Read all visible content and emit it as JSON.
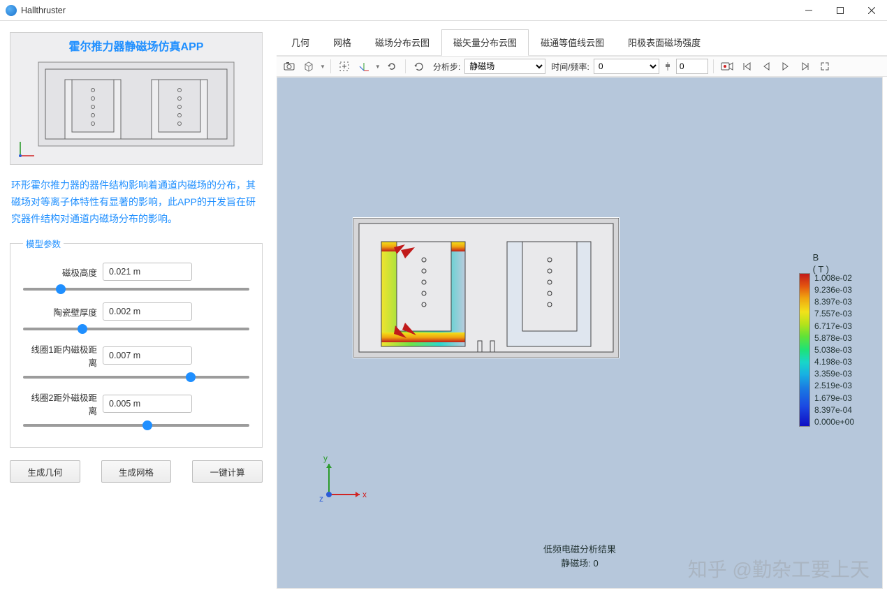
{
  "window": {
    "title": "Hallthruster"
  },
  "sidebar": {
    "preview_title": "霍尔推力器静磁场仿真APP",
    "description": "环形霍尔推力器的器件结构影响着通道内磁场的分布，其磁场对等离子体特性有显著的影响，此APP的开发旨在研究器件结构对通道内磁场分布的影响。",
    "params_legend": "模型参数",
    "params": [
      {
        "label": "磁极高度",
        "value": "0.021 m",
        "slider": 15
      },
      {
        "label": "陶瓷壁厚度",
        "value": "0.002 m",
        "slider": 25
      },
      {
        "label": "线圈1距内磁极距离",
        "value": "0.007 m",
        "slider": 75
      },
      {
        "label": "线圈2距外磁极距离",
        "value": "0.005 m",
        "slider": 55
      }
    ]
  },
  "actions": {
    "gen_geom": "生成几何",
    "gen_mesh": "生成网格",
    "compute": "一键计算"
  },
  "tabs": [
    {
      "label": "几何"
    },
    {
      "label": "网格"
    },
    {
      "label": "磁场分布云图"
    },
    {
      "label": "磁矢量分布云图",
      "active": true
    },
    {
      "label": "磁通等值线云图"
    },
    {
      "label": "阳极表面磁场强度"
    }
  ],
  "toolbar": {
    "analysis_step_label": "分析步:",
    "analysis_step_value": "静磁场",
    "time_freq_label": "时间/频率:",
    "time_freq_value": "0",
    "spin_value": "0"
  },
  "viewport": {
    "caption_line1": "低频电磁分析结果",
    "caption_line2": "静磁场: 0",
    "legend_title1": "B",
    "legend_title2": "( T )",
    "axes": {
      "x": "x",
      "y": "y",
      "z": "z"
    }
  },
  "chart_data": {
    "type": "heatmap",
    "title": "B (T)",
    "colorbar_ticks": [
      "1.008e-02",
      "9.236e-03",
      "8.397e-03",
      "7.557e-03",
      "6.717e-03",
      "5.878e-03",
      "5.038e-03",
      "4.198e-03",
      "3.359e-03",
      "2.519e-03",
      "1.679e-03",
      "8.397e-04",
      "0.000e+00"
    ],
    "range": [
      0.0,
      0.01008
    ]
  },
  "watermark": "知乎 @勤杂工要上天"
}
